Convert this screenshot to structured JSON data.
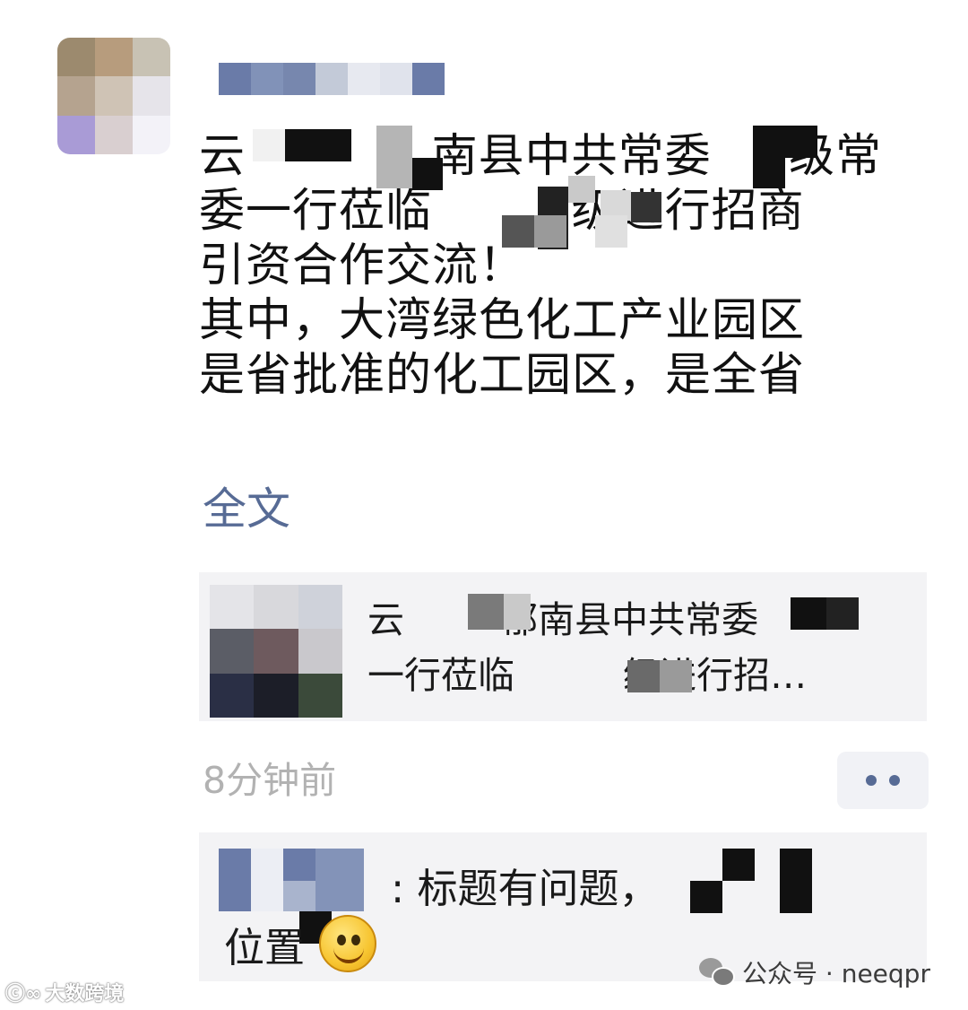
{
  "post": {
    "text": "云 　　 　 南县中共常委 　 级常\n委一行莅临 　 　 级进行招商\n引资合作交流！\n其中，大湾绿色化工产业园区\n是省批准的化工园区，是全省",
    "full_text_link": "全文"
  },
  "link_card": {
    "title": "云 　 　郁南县中共常委 　\n一行莅临 　 　 级进行招…"
  },
  "meta": {
    "time": "8分钟前"
  },
  "comment": {
    "text_line1": ": 标题有问题，",
    "text_line2": "位置"
  },
  "watermarks": {
    "left": "大数跨境",
    "right": "公众号 · neeqpr"
  },
  "colors": {
    "link_blue": "#576b95",
    "card_bg": "#f3f3f5",
    "timestamp_gray": "#b2b2b2"
  },
  "icons": [
    "avatar-image",
    "more-options-icon",
    "smile-emoji-icon",
    "wechat-icon"
  ]
}
